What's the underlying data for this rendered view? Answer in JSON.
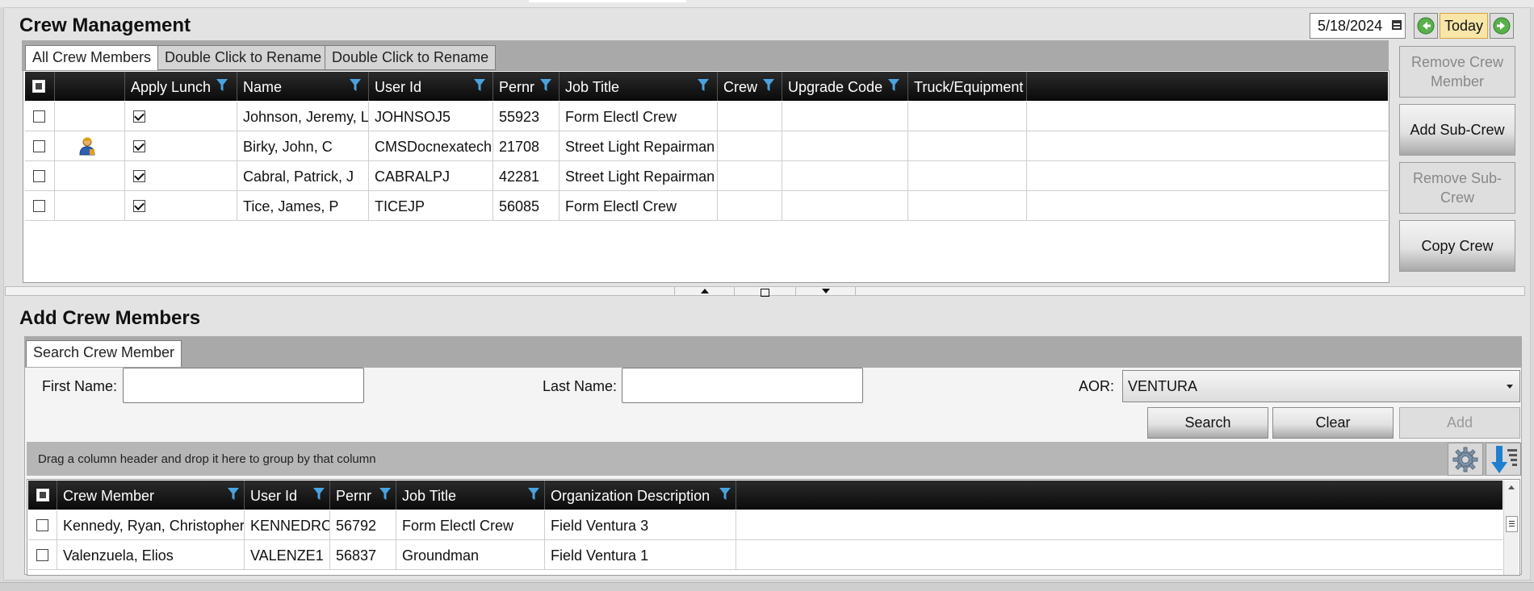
{
  "crew_management": {
    "title": "Crew Management",
    "date": "5/18/2024",
    "today_label": "Today",
    "tabs": [
      "All Crew Members",
      "Double Click to Rename",
      "Double Click to Rename"
    ],
    "columns": [
      "Apply Lunch",
      "Name",
      "User Id",
      "Pernr",
      "Job Title",
      "Crew",
      "Upgrade Code",
      "Truck/Equipment"
    ],
    "rows": [
      {
        "apply_lunch": true,
        "has_icon": false,
        "name": "Johnson, Jeremy, L",
        "user_id": "JOHNSOJ5",
        "pernr": "55923",
        "job_title": "Form Electl Crew",
        "crew": "",
        "upgrade_code": "",
        "truck": ""
      },
      {
        "apply_lunch": true,
        "has_icon": true,
        "name": "Birky, John, C",
        "user_id": "CMSDocnexatech",
        "pernr": "21708",
        "job_title": "Street Light Repairman",
        "crew": "",
        "upgrade_code": "",
        "truck": ""
      },
      {
        "apply_lunch": true,
        "has_icon": false,
        "name": "Cabral, Patrick, J",
        "user_id": "CABRALPJ",
        "pernr": "42281",
        "job_title": "Street Light Repairman",
        "crew": "",
        "upgrade_code": "",
        "truck": ""
      },
      {
        "apply_lunch": true,
        "has_icon": false,
        "name": "Tice, James, P",
        "user_id": "TICEJP",
        "pernr": "56085",
        "job_title": "Form Electl Crew",
        "crew": "",
        "upgrade_code": "",
        "truck": ""
      }
    ],
    "side_buttons": {
      "remove_member": "Remove Crew Member",
      "add_subcrew": "Add Sub-Crew",
      "remove_subcrew": "Remove Sub-Crew",
      "copy_crew": "Copy Crew"
    }
  },
  "add_crew_members": {
    "title": "Add Crew Members",
    "tab": "Search Crew Member",
    "first_name_label": "First Name:",
    "first_name_value": "",
    "last_name_label": "Last Name:",
    "last_name_value": "",
    "aor_label": "AOR:",
    "aor_value": "VENTURA",
    "search_label": "Search",
    "clear_label": "Clear",
    "add_label": "Add",
    "group_hint": "Drag a column header and drop it here to group by that column",
    "columns": [
      "Crew Member",
      "User Id",
      "Pernr",
      "Job Title",
      "Organization Description"
    ],
    "rows": [
      {
        "crew_member": "Kennedy, Ryan, Christopher",
        "user_id": "KENNEDRC",
        "pernr": "56792",
        "job_title": "Form Electl Crew",
        "org": "Field Ventura 3"
      },
      {
        "crew_member": "Valenzuela, Elios",
        "user_id": "VALENZE1",
        "pernr": "56837",
        "job_title": "Groundman",
        "org": "Field Ventura 1"
      }
    ]
  },
  "colors": {
    "header_bg": "#111111",
    "filter_icon": "#4aa3df",
    "tabstrip": "#a9a9a9"
  }
}
